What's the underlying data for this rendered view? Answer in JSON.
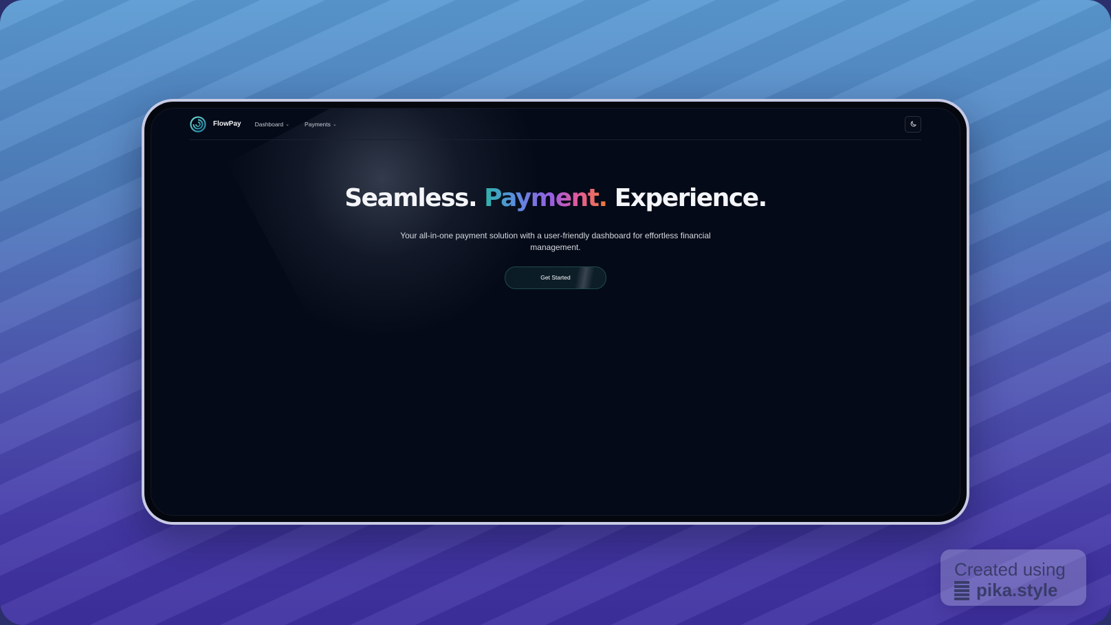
{
  "app": {
    "brand": "FlowPay"
  },
  "nav": {
    "items": [
      {
        "label": "Dashboard"
      },
      {
        "label": "Payments"
      }
    ],
    "theme_toggle_icon": "moon-icon"
  },
  "hero": {
    "headline_part1": "Seamless.",
    "headline_highlight": "Payment.",
    "headline_part3": "Experience.",
    "subtitle": "Your all-in-one payment solution with a user-friendly dashboard for effortless financial management.",
    "cta_label": "Get Started"
  },
  "watermark": {
    "line1": "Created using",
    "line2": "pika.style"
  },
  "colors": {
    "screen_bg": "#040a17",
    "highlight_gradient": [
      "#2fb4a8",
      "#5a8de0",
      "#9a5de0",
      "#e05aa0",
      "#f07a3a"
    ]
  }
}
